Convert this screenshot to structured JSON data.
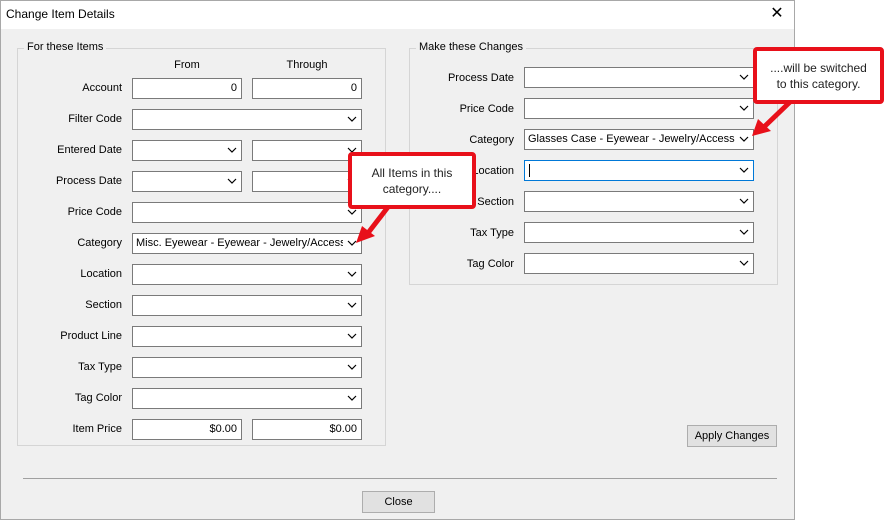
{
  "window": {
    "title": "Change Item Details",
    "close_glyph": "✕"
  },
  "left_group": {
    "legend": "For these Items",
    "col_from": "From",
    "col_through": "Through",
    "rows": [
      {
        "label": "Account",
        "from": "0",
        "through": "0"
      },
      {
        "label": "Filter Code",
        "value": ""
      },
      {
        "label": "Entered Date",
        "from": "",
        "through": ""
      },
      {
        "label": "Process Date",
        "from": "",
        "through": ""
      },
      {
        "label": "Price Code",
        "value": ""
      },
      {
        "label": "Category",
        "value": "Misc. Eyewear - Eyewear - Jewelry/Accessories"
      },
      {
        "label": "Location",
        "value": ""
      },
      {
        "label": "Section",
        "value": ""
      },
      {
        "label": "Product Line",
        "value": ""
      },
      {
        "label": "Tax Type",
        "value": ""
      },
      {
        "label": "Tag Color",
        "value": ""
      },
      {
        "label": "Item Price",
        "from": "$0.00",
        "through": "$0.00"
      }
    ]
  },
  "right_group": {
    "legend": "Make these Changes",
    "rows": [
      {
        "label": "Process Date",
        "value": ""
      },
      {
        "label": "Price Code",
        "value": ""
      },
      {
        "label": "Category",
        "value": "Glasses Case - Eyewear - Jewelry/Accessories"
      },
      {
        "label": "Location",
        "value": ""
      },
      {
        "label": "Section",
        "value": ""
      },
      {
        "label": "Tax Type",
        "value": ""
      },
      {
        "label": "Tag Color",
        "value": ""
      }
    ]
  },
  "buttons": {
    "apply": "Apply Changes",
    "close": "Close"
  },
  "callouts": {
    "left_line1": "All Items in this",
    "left_line2": "category....",
    "right_line1": "....will be switched",
    "right_line2": "to this category."
  },
  "colors": {
    "callout_red": "#e8101a",
    "focus_blue": "#0078d7"
  },
  "icons": {
    "dropdown": "chevron-down-icon",
    "close": "close-icon"
  }
}
